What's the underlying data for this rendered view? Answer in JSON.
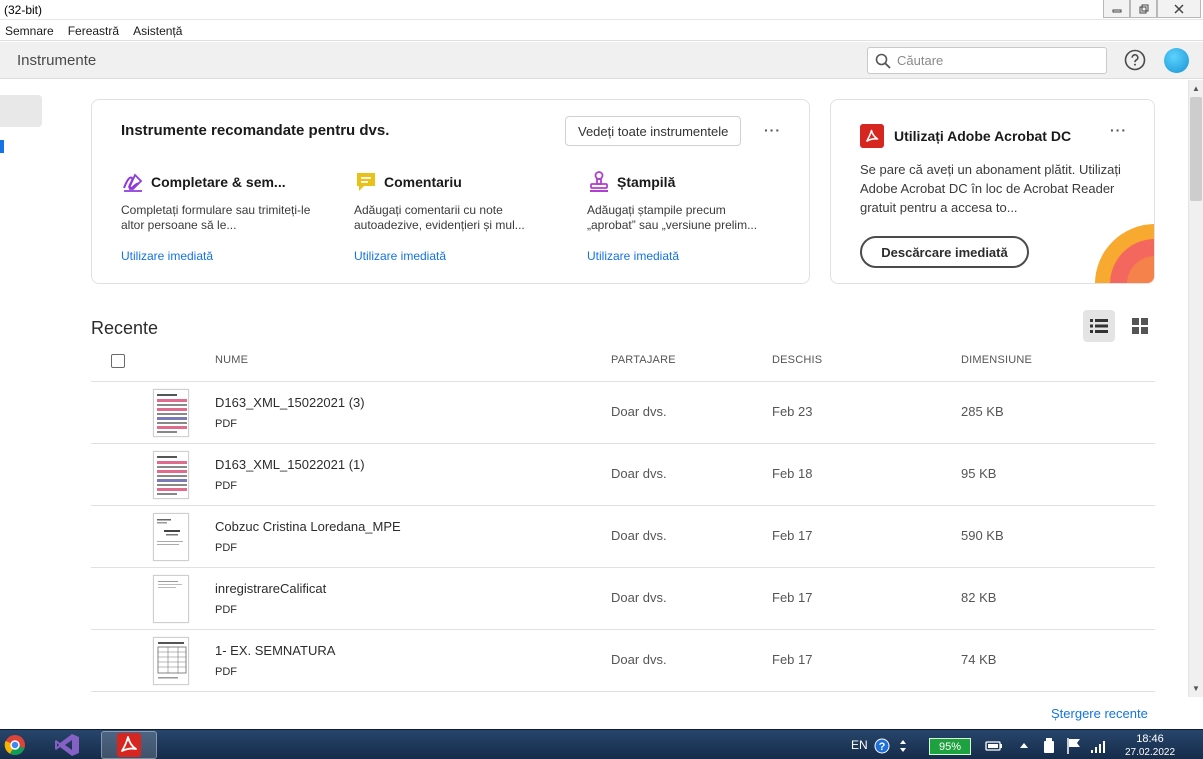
{
  "window": {
    "title": "(32-bit)",
    "controls": [
      "minimize",
      "restore",
      "close"
    ]
  },
  "menubar": {
    "items": [
      "Semnare",
      "Fereastră",
      "Asistență"
    ]
  },
  "toolbar": {
    "label": "Instrumente",
    "search_placeholder": "Căutare"
  },
  "recommended": {
    "title": "Instrumente recomandate pentru dvs.",
    "see_all": "Vedeți toate instrumentele",
    "more": "···",
    "tools": [
      {
        "name": "Completare & sem...",
        "desc": "Completați formulare sau trimiteți-le altor persoane să le...",
        "link": "Utilizare imediată",
        "icon": "fill-sign-icon",
        "color": "#8e3bd9"
      },
      {
        "name": "Comentariu",
        "desc": "Adăugați comentarii cu note autoadezive, evidențieri și mul...",
        "link": "Utilizare imediată",
        "icon": "comment-icon",
        "color": "#e8c218"
      },
      {
        "name": "Ștampilă",
        "desc": "Adăugați ștampile precum „aprobat” sau „versiune prelim...",
        "link": "Utilizare imediată",
        "icon": "stamp-icon",
        "color": "#b03fcf"
      }
    ]
  },
  "promo": {
    "title": "Utilizați Adobe Acrobat DC",
    "text": "Se pare că aveți un abonament plătit. Utilizați Adobe Acrobat DC în loc de Acrobat Reader gratuit pentru a accesa to...",
    "button": "Descărcare imediată",
    "more": "···",
    "icon": "acrobat-icon",
    "color": "#d7261f"
  },
  "recent": {
    "title": "Recente",
    "columns": [
      "NUME",
      "PARTAJARE",
      "DESCHIS",
      "DIMENSIUNE"
    ],
    "rows": [
      {
        "name": "D163_XML_15022021 (3)",
        "type": "PDF",
        "sharing": "Doar dvs.",
        "opened": "Feb 23",
        "size": "285 KB",
        "thumb": "form-red"
      },
      {
        "name": "D163_XML_15022021 (1)",
        "type": "PDF",
        "sharing": "Doar dvs.",
        "opened": "Feb 18",
        "size": "95 KB",
        "thumb": "form-red"
      },
      {
        "name": "Cobzuc Cristina Loredana_MPE",
        "type": "PDF",
        "sharing": "Doar dvs.",
        "opened": "Feb 17",
        "size": "590 KB",
        "thumb": "doc-letter"
      },
      {
        "name": "inregistrareCalificat",
        "type": "PDF",
        "sharing": "Doar dvs.",
        "opened": "Feb 17",
        "size": "82 KB",
        "thumb": "doc-blank"
      },
      {
        "name": "1- EX. SEMNATURA",
        "type": "PDF",
        "sharing": "Doar dvs.",
        "opened": "Feb 17",
        "size": "74 KB",
        "thumb": "doc-table"
      }
    ],
    "clear": "Ștergere recente"
  },
  "taskbar": {
    "lang": "EN",
    "battery": "95%",
    "time": "18:46",
    "date": "27.02.2022"
  }
}
